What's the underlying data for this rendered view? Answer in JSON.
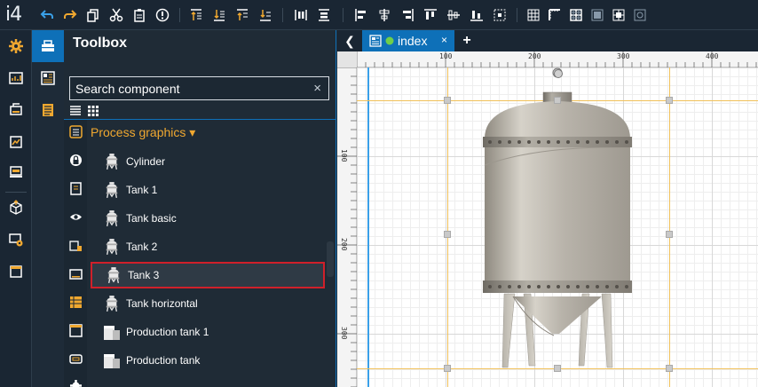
{
  "app": {
    "logo": "i4"
  },
  "toolbox": {
    "title": "Toolbox",
    "search_placeholder": "Search component",
    "clear_icon": "×",
    "category": "Process graphics ▾",
    "items": [
      {
        "label": "Cylinder",
        "icon": "tank-small-icon"
      },
      {
        "label": "Tank 1",
        "icon": "tank-small-icon"
      },
      {
        "label": "Tank basic",
        "icon": "tank-small-icon"
      },
      {
        "label": "Tank 2",
        "icon": "tank-small-icon"
      },
      {
        "label": "Tank 3",
        "icon": "tank-small-icon",
        "selected": true
      },
      {
        "label": "Tank horizontal",
        "icon": "tank-small-icon"
      },
      {
        "label": "Production tank 1",
        "icon": "production-tank-icon"
      },
      {
        "label": "Production tank",
        "icon": "production-tank-icon"
      }
    ]
  },
  "editor": {
    "back_icon": "❮",
    "tab": {
      "label": "index",
      "close": "×"
    },
    "add_tab": "+",
    "ruler_top": [
      "100",
      "200",
      "300",
      "400"
    ],
    "ruler_left": [
      "100",
      "200",
      "300"
    ]
  },
  "colors": {
    "accent": "#0e70b8",
    "category": "#f0a830",
    "selection_border": "#d0202a",
    "guide": "#f1c15a",
    "toolbar_icon_orange": "#f0a830",
    "toolbar_icon_blue": "#3aa0e8"
  }
}
